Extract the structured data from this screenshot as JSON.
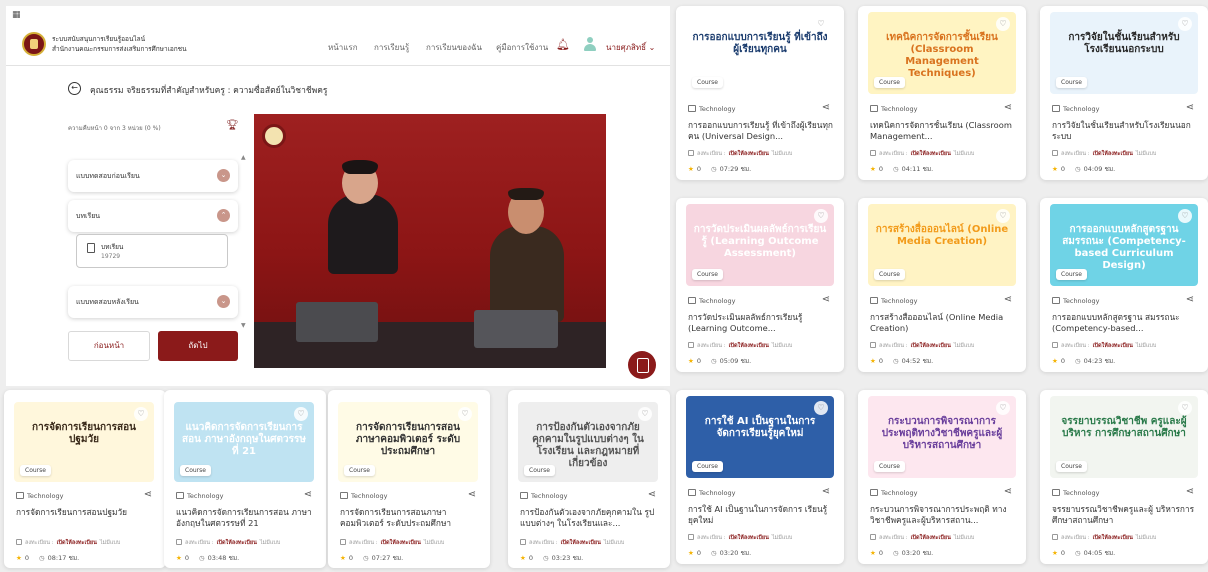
{
  "learning": {
    "org_line1": "ระบบสนับสนุนการเรียนรู้ออนไลน์",
    "org_line2": "สำนักงานคณะกรรมการส่งเสริมการศึกษาเอกชน",
    "nav": [
      "หน้าแรก",
      "การเรียนรู้",
      "การเรียนของฉัน",
      "คู่มือการใช้งาน"
    ],
    "user_name": "นายศุภสิทธิ์",
    "course_title": "คุณธรรม จริยธรรมที่สำคัญสำหรับครู : ความซื่อสัตย์ในวิชาชีพครู",
    "progress_text": "ความคืบหน้า 0 จาก 3 หน่วย (0 %)",
    "modules": [
      "แบบทดสอบก่อนเรียน",
      "บทเรียน",
      "แบบทดสอบหลังเรียน"
    ],
    "lesson": {
      "title": "บทเรียน",
      "code": "19729"
    },
    "prev_label": "ก่อนหน้า",
    "next_label": "ถัดไป",
    "colors": {
      "brand": "#8b1a1a"
    }
  },
  "common": {
    "category": "Technology",
    "badge": "Course",
    "meta_prefix": "ลงทะเบียน :",
    "meta_status": "เปิดให้ลงทะเบียน",
    "meta_suffix": "ไม่มีแบบ"
  },
  "right_cards": [
    {
      "thumb_text": "การออกแบบการเรียนรู้ ที่เข้าถึงผู้เรียนทุกคน",
      "bg": "#ffffff",
      "fg": "#1b3c6e",
      "title": "การออกแบบการเรียนรู้ ที่เข้าถึงผู้เรียนทุกคน (Universal Design...",
      "rating": "0",
      "duration": "07:29 ชม."
    },
    {
      "thumb_text": "เทคนิคการจัดการชั้นเรียน (Classroom Management Techniques)",
      "bg": "#fff4c2",
      "fg": "#d9731f",
      "title": "เทคนิคการจัดการชั้นเรียน (Classroom Management...",
      "rating": "0",
      "duration": "04:11 ชม."
    },
    {
      "thumb_text": "การวิจัยในชั้นเรียนสำหรับ โรงเรียนนอกระบบ",
      "bg": "#e9f3fb",
      "fg": "#2a2a2a",
      "title": "การวิจัยในชั้นเรียนสำหรับโรงเรียนนอกระบบ",
      "rating": "0",
      "duration": "04:09 ชม."
    },
    {
      "thumb_text": "การวัดประเมินผลลัพธ์การเรียนรู้ (Learning Outcome Assessment)",
      "bg": "#f7d6e0",
      "fg": "#ffffff",
      "title": "การวัดประเมินผลลัพธ์การเรียนรู้ (Learning Outcome...",
      "rating": "0",
      "duration": "05:09 ชม."
    },
    {
      "thumb_text": "การสร้างสื่อออนไลน์ (Online Media Creation)",
      "bg": "#fff3c4",
      "fg": "#f29b1b",
      "title": "การสร้างสื่อออนไลน์ (Online Media Creation)",
      "rating": "0",
      "duration": "04:52 ชม."
    },
    {
      "thumb_text": "การออกแบบหลักสูตรฐานสมรรถนะ (Competency-based Curriculum Design)",
      "bg": "#6fd3e6",
      "fg": "#ffffff",
      "title": "การออกแบบหลักสูตรฐาน สมรรถนะ (Competency-based...",
      "rating": "0",
      "duration": "04:23 ชม."
    },
    {
      "thumb_text": "การใช้ AI เป็นฐานในการจัดการเรียนรู้ยุคใหม่",
      "bg": "#2e5fa8",
      "fg": "#ffffff",
      "title": "การใช้ AI เป็นฐานในการจัดการ เรียนรู้ยุคใหม่",
      "rating": "0",
      "duration": "03:20 ชม."
    },
    {
      "thumb_text": "กระบวนการพิจารณาการประพฤติทางวิชาชีพครูและผู้บริหารสถานศึกษา",
      "bg": "#fde7ef",
      "fg": "#6a3f9c",
      "title": "กระบวนการพิจารณาการประพฤติ ทางวิชาชีพครูและผู้บริหารสถาน...",
      "rating": "0",
      "duration": "03:20 ชม."
    },
    {
      "thumb_text": "จรรยาบรรณวิชาชีพ ครูและผู้บริหาร การศึกษาสถานศึกษา",
      "bg": "#f2f5f0",
      "fg": "#2a7a4a",
      "title": "จรรยาบรรณวิชาชีพครูและผู้ บริหารการศึกษาสถานศึกษา",
      "rating": "0",
      "duration": "04:05 ชม."
    }
  ],
  "bottom_cards": [
    {
      "thumb_text": "การจัดการเรียนการสอน ปฐมวัย",
      "bg": "#fff7dc",
      "fg": "#3a2a1a",
      "title": "การจัดการเรียนการสอนปฐมวัย",
      "rating": "0",
      "duration": "08:17 ชม."
    },
    {
      "thumb_text": "แนวคิดการจัดการเรียนการสอน ภาษาอังกฤษในศตวรรษที่ 21",
      "bg": "#bfe3f2",
      "fg": "#ffffff",
      "title": "แนวคิดการจัดการเรียนการสอน ภาษาอังกฤษในศตวรรษที่ 21",
      "rating": "0",
      "duration": "03:48 ชม."
    },
    {
      "thumb_text": "การจัดการเรียนการสอนภาษาคอมพิวเตอร์ ระดับประถมศึกษา",
      "bg": "#fffbe6",
      "fg": "#333333",
      "title": "การจัดการเรียนการสอนภาษา คอมพิวเตอร์ ระดับประถมศึกษา",
      "rating": "0",
      "duration": "07:27 ชม."
    },
    {
      "thumb_text": "การป้องกันตัวเองจากภัยคุกคามในรูปแบบต่างๆ ในโรงเรียน และกฎหมายที่เกี่ยวข้อง",
      "bg": "#eeeeee",
      "fg": "#555555",
      "title": "การป้องกันตัวเองจากภัยคุกคามใน รูปแบบต่างๆ ในโรงเรียนและ...",
      "rating": "0",
      "duration": "03:23 ชม."
    }
  ]
}
